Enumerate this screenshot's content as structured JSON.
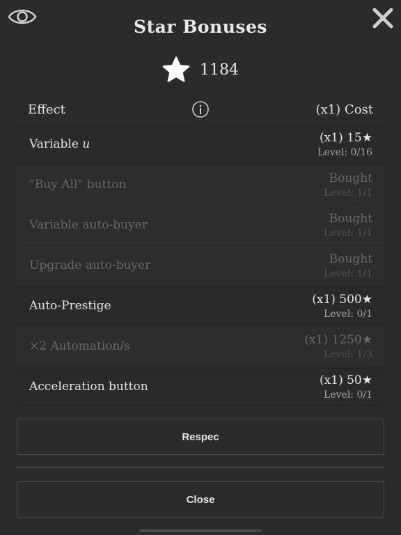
{
  "title": "Star Bonuses",
  "stars": "1184",
  "header": {
    "effect": "Effect",
    "cost": "(x1) Cost"
  },
  "colors": {
    "background": "#2b2b2b",
    "row_active": "#2a2a2a",
    "text": "#e6e6e6",
    "dim_text": "#6a6a6a"
  },
  "icons": {
    "visibility": "eye-icon",
    "close": "close-icon",
    "currency": "star-icon",
    "info": "info-icon"
  },
  "rows": [
    {
      "effect_prefix": "Variable ",
      "effect_var": "u",
      "cost": "(x1) 15",
      "star": "★",
      "level": "Level: 0/16"
    },
    {
      "effect": "\"Buy All\" button",
      "cost": "Bought",
      "level": "Level: 1/1"
    },
    {
      "effect": "Variable auto-buyer",
      "cost": "Bought",
      "level": "Level: 1/1"
    },
    {
      "effect": "Upgrade auto-buyer",
      "cost": "Bought",
      "level": "Level: 1/1"
    },
    {
      "effect": "Auto-Prestige",
      "cost": "(x1) 500",
      "star": "★",
      "level": "Level: 0/1"
    },
    {
      "effect": "×2 Automation/s",
      "cost": "(x1) 1250",
      "star": "★",
      "level": "Level: 1/3"
    },
    {
      "effect": "Acceleration button",
      "cost": "(x1) 50",
      "star": "★",
      "level": "Level: 0/1"
    }
  ],
  "buttons": {
    "respec": "Respec",
    "close": "Close"
  }
}
